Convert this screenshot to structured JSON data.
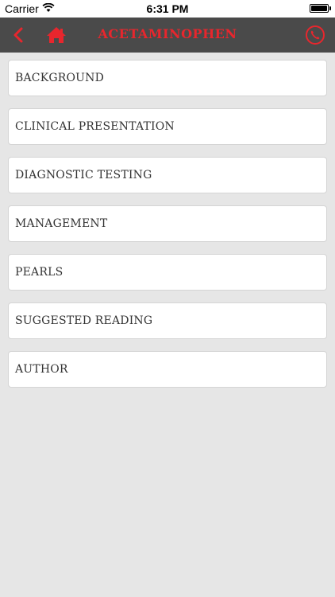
{
  "status_bar": {
    "carrier": "Carrier",
    "time": "6:31 PM",
    "icons": [
      "wifi-icon",
      "battery-icon"
    ]
  },
  "nav": {
    "title": "ACETAMINOPHEN",
    "icons": [
      "chevron-left-icon",
      "home-icon",
      "phone-icon"
    ],
    "accent_color": "#e8262d",
    "background_color": "#4a4a4a"
  },
  "menu": {
    "items": [
      {
        "label": "BACKGROUND"
      },
      {
        "label": "CLINICAL PRESENTATION"
      },
      {
        "label": "DIAGNOSTIC TESTING"
      },
      {
        "label": "MANAGEMENT"
      },
      {
        "label": "PEARLS"
      },
      {
        "label": "SUGGESTED READING"
      },
      {
        "label": "AUTHOR"
      }
    ]
  }
}
